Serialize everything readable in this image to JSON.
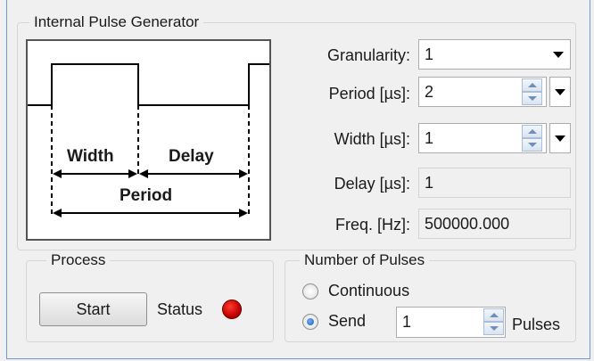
{
  "pulse_generator": {
    "title": "Internal Pulse Generator",
    "diagram": {
      "width_label": "Width",
      "delay_label": "Delay",
      "period_label": "Period"
    },
    "granularity": {
      "label": "Granularity:",
      "value": "1"
    },
    "period": {
      "label": "Period [µs]:",
      "value": "2"
    },
    "width": {
      "label": "Width [µs]:",
      "value": "1"
    },
    "delay": {
      "label": "Delay [µs]:",
      "value": "1"
    },
    "freq": {
      "label": "Freq. [Hz]:",
      "value": "500000.000"
    }
  },
  "process": {
    "title": "Process",
    "start_label": "Start",
    "status_label": "Status",
    "status_color": "#c20000"
  },
  "pulses": {
    "title": "Number of Pulses",
    "continuous_label": "Continuous",
    "send_label": "Send",
    "send_count": "1",
    "units_label": "Pulses",
    "selected": "send"
  }
}
